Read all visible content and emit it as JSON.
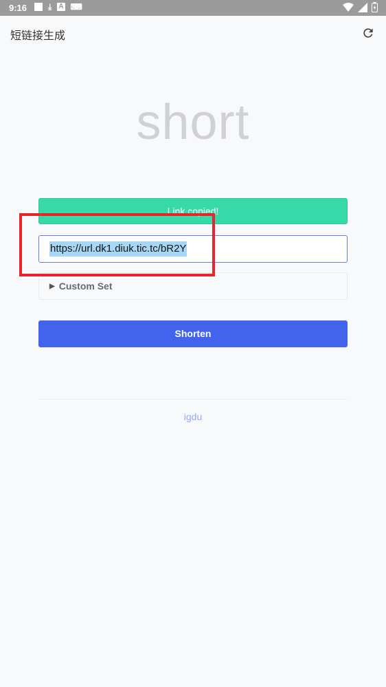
{
  "status_bar": {
    "time": "9:16",
    "download_glyph": "⤓",
    "a_glyph": "A",
    "keyboard_glyph": "⌨"
  },
  "app_bar": {
    "title": "短链接生成",
    "refresh_icon": "refresh-icon"
  },
  "brand": {
    "logo_text": "short"
  },
  "banner": {
    "text": "Link copied!",
    "color": "#38d9a9"
  },
  "url_field": {
    "value": "https://url.dk1.diuk.tic.tc/bR2Y"
  },
  "custom_set": {
    "label": "Custom Set",
    "marker": "▶"
  },
  "shorten_button": {
    "label": "Shorten",
    "color": "#4263eb"
  },
  "footer": {
    "link_text": "igdu"
  },
  "annotation": {
    "color": "#e8242c"
  }
}
